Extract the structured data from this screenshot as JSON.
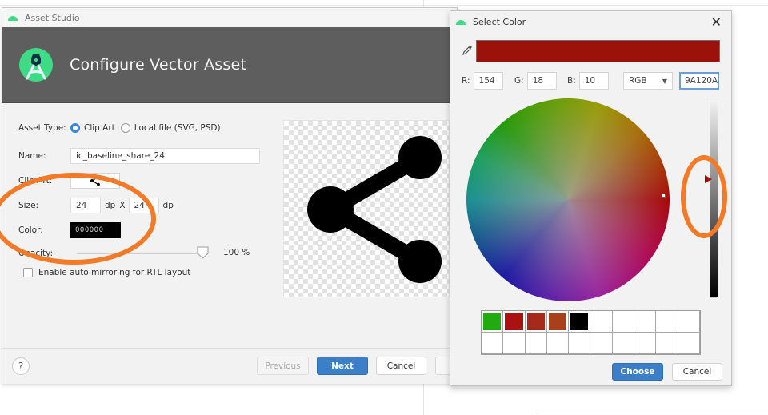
{
  "asset_studio": {
    "window_title": "Asset Studio",
    "heading": "Configure Vector Asset",
    "form": {
      "asset_type_label": "Asset Type:",
      "asset_type_options": [
        {
          "label": "Clip Art",
          "selected": true
        },
        {
          "label": "Local file (SVG, PSD)",
          "selected": false
        }
      ],
      "name_label": "Name:",
      "name_value": "ic_baseline_share_24",
      "clip_art_label": "Clip Art:",
      "clip_art_icon": "share-icon",
      "size_label": "Size:",
      "size_width": "24",
      "size_height": "24",
      "size_unit": "dp",
      "size_separator": "X",
      "color_label": "Color:",
      "color_value": "000000",
      "opacity_label": "Opacity:",
      "opacity_percent": 100,
      "opacity_text": "100 %",
      "rtl_label": "Enable auto mirroring for RTL layout",
      "rtl_checked": false
    },
    "preview_icon": "share-icon",
    "footer": {
      "help": "?",
      "previous": "Previous",
      "next": "Next",
      "cancel": "Cancel",
      "finish": ""
    }
  },
  "color_dialog": {
    "title": "Select Color",
    "close": "✕",
    "current_color": "#9A120A",
    "r_label": "R:",
    "r_value": "154",
    "g_label": "G:",
    "g_value": "18",
    "b_label": "B:",
    "b_value": "10",
    "mode": "RGB",
    "hex_value": "9A120A",
    "brightness_fraction": 0.4,
    "recent_colors": [
      "#22aa11",
      "#aa1111",
      "#a52a1a",
      "#a8401c",
      "#000000",
      "#ffffff",
      "#ffffff",
      "#ffffff",
      "#ffffff",
      "#ffffff",
      "#ffffff",
      "#ffffff",
      "#ffffff",
      "#ffffff",
      "#ffffff",
      "#ffffff",
      "#ffffff",
      "#ffffff",
      "#ffffff",
      "#ffffff"
    ],
    "choose": "Choose",
    "cancel": "Cancel"
  },
  "annotations": {
    "color": "#f47a27"
  }
}
